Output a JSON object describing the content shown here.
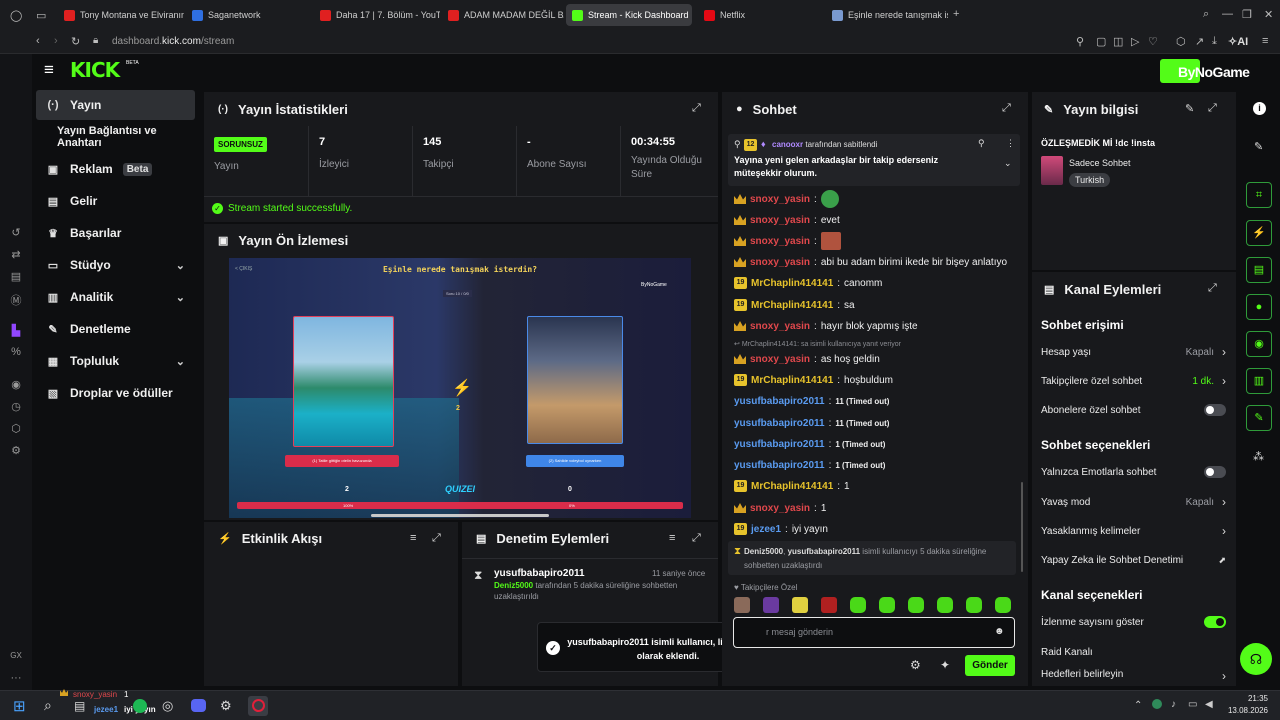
{
  "browser": {
    "tabs": [
      {
        "label": "Tony Montana ve Elviranın",
        "color": "#e02020"
      },
      {
        "label": "Saganetwork",
        "color": "#2f6fe0"
      },
      {
        "label": "Daha 17 | 7. Bölüm - YouTu",
        "color": "#e02020"
      },
      {
        "label": "ADAM MADAM DEĞİL BAM",
        "color": "#e02020"
      },
      {
        "label": "Stream - Kick Dashboard",
        "color": "#53fc18"
      },
      {
        "label": "Netflix",
        "color": "#e50914"
      },
      {
        "label": "Eşinle nerede tanışmak iste",
        "color": "#7a9ad0"
      }
    ],
    "new_tab": "+",
    "url_host": "dashboard.",
    "url_domain": "kick.com",
    "url_path": "/stream",
    "ai_label": "AI",
    "gx_label": "GX"
  },
  "kick": {
    "logo": "KICK",
    "logo_beta": "BETA",
    "brand": "ByNoGame"
  },
  "nav": [
    {
      "label": "Yayın",
      "icon": "broadcast-icon",
      "glyph": "(·)"
    },
    {
      "label": "Yayın Bağlantısı ve Anahtarı",
      "icon": "",
      "glyph": ""
    },
    {
      "label": "Reklam",
      "icon": "ad-icon",
      "glyph": "▣",
      "badge": "Beta"
    },
    {
      "label": "Gelir",
      "icon": "revenue-icon",
      "glyph": "▤"
    },
    {
      "label": "Başarılar",
      "icon": "trophy-icon",
      "glyph": "♛"
    },
    {
      "label": "Stüdyo",
      "icon": "studio-icon",
      "glyph": "▭"
    },
    {
      "label": "Analitik",
      "icon": "analytics-icon",
      "glyph": "▥"
    },
    {
      "label": "Denetleme",
      "icon": "wrench-icon",
      "glyph": "✎"
    },
    {
      "label": "Topluluk",
      "icon": "community-icon",
      "glyph": "▦"
    },
    {
      "label": "Droplar ve ödüller",
      "icon": "drops-icon",
      "glyph": "▧"
    }
  ],
  "stats": {
    "title": "Yayın İstatistikleri",
    "status_badge": "SORUNSUZ",
    "status_label": "Yayın",
    "viewers": "7",
    "viewers_label": "İzleyici",
    "followers": "145",
    "followers_label": "Takipçi",
    "subs": "-",
    "subs_label": "Abone Sayısı",
    "uptime": "00:34:55",
    "uptime_label": "Yayında Olduğu Süre",
    "success_msg": "Stream started successfully."
  },
  "preview": {
    "title": "Yayın Ön İzlemesi",
    "quiz_title": "Eşinle nerede tanışmak isterdin?",
    "left_option": "(1) Tatile gittiğin otelin havuzunda",
    "right_option": "(2) Sahilde voleybol oynarken",
    "left_score": "2",
    "right_score": "0",
    "center_score": "2",
    "logo": "QUIZEI",
    "top_label": "Soru 10 / 0/0",
    "back": "< ÇIKIŞ",
    "watermark": "ByNoGame",
    "left_pct": "100%",
    "right_pct": "0%"
  },
  "events": {
    "title": "Etkinlik Akışı"
  },
  "moderation": {
    "title": "Denetim Eylemleri",
    "item_user": "yusufbabapiro2011",
    "item_time": "11 saniye önce",
    "item_actor": "Deniz5000",
    "item_text": " tarafından 5 dakika süreliğine sohbetten uzaklaştırıldı"
  },
  "toast": {
    "text": "yusufbabapiro2011 isimli kullanıcı, listenize vip olarak eklendi."
  },
  "chat": {
    "title": "Sohbet",
    "pinned_badge": "12",
    "pinned_by": "canooxr",
    "pinned_by_suffix": " tarafından sabitlendi",
    "pinned_text": "Yayına yeni gelen arkadaşlar bir takip ederseniz müteşekkir olurum.",
    "messages": [
      {
        "user": "snoxy_yasin",
        "text": "",
        "badge": "crown",
        "color": "red",
        "emote": "#3aa04a"
      },
      {
        "user": "snoxy_yasin",
        "text": "evet",
        "badge": "crown",
        "color": "red"
      },
      {
        "user": "snoxy_yasin",
        "text": "",
        "badge": "crown",
        "color": "red",
        "emote": "#b0533e"
      },
      {
        "user": "snoxy_yasin",
        "text": "abi bu adam birimi ikede bir bişey anlatıyo",
        "badge": "crown",
        "color": "red"
      },
      {
        "user": "MrChaplin414141",
        "text": "canomm",
        "badge": "19",
        "color": "yel"
      },
      {
        "user": "MrChaplin414141",
        "text": "sa",
        "badge": "19",
        "color": "yel"
      },
      {
        "user": "snoxy_yasin",
        "text": "hayır blok yapmış işte",
        "badge": "crown",
        "color": "red"
      },
      {
        "user": "snoxy_yasin",
        "text": "as hoş geldin",
        "badge": "crown",
        "color": "red"
      },
      {
        "user": "MrChaplin414141",
        "text": "hoşbuldum",
        "badge": "19",
        "color": "yel"
      },
      {
        "user": "yusufbabapiro2011",
        "text": "11 (Timed out)",
        "badge": "",
        "color": "blue"
      },
      {
        "user": "yusufbabapiro2011",
        "text": "11 (Timed out)",
        "badge": "",
        "color": "blue"
      },
      {
        "user": "yusufbabapiro2011",
        "text": "1 (Timed out)",
        "badge": "",
        "color": "blue"
      },
      {
        "user": "yusufbabapiro2011",
        "text": "1 (Timed out)",
        "badge": "",
        "color": "blue"
      },
      {
        "user": "MrChaplin414141",
        "text": "1",
        "badge": "19",
        "color": "yel"
      },
      {
        "user": "snoxy_yasin",
        "text": "1",
        "badge": "crown",
        "color": "red"
      },
      {
        "user": "jezee1",
        "text": "iyi yayın",
        "badge": "19",
        "color": "blue"
      }
    ],
    "reply_hint": "MrChaplin414141: sa isimli kullanıcıya yanıt veriyor",
    "timeout_notice_actor": "Deniz5000",
    "timeout_notice_target": "yusufbabapiro2011",
    "timeout_notice_text": " isimli kullanıcıyı 5 dakika süreliğine sohbetten uzaklaştırdı",
    "emote_row_label": "♥ Takipçilere Özel",
    "input_placeholder": "r mesaj gönderin",
    "send": "Gönder"
  },
  "stream_info": {
    "title": "Yayın bilgisi",
    "stream_title": "ÖZLEŞMEDİK Mİ !dc !insta",
    "category": "Sadece Sohbet",
    "language": "Turkish"
  },
  "channel_actions": {
    "title": "Kanal Eylemleri",
    "chat_access": "Sohbet erişimi",
    "account_age": "Hesap yaşı",
    "account_age_val": "Kapalı",
    "followers_only": "Takipçilere özel sohbet",
    "followers_only_val": "1 dk.",
    "subs_only": "Abonelere özel sohbet",
    "chat_options": "Sohbet seçenekleri",
    "emotes_only": "Yalnızca Emotlarla sohbet",
    "slow_mode": "Yavaş mod",
    "slow_mode_val": "Kapalı",
    "banned_words": "Yasaklanmış kelimeler",
    "ai_mod": "Yapay Zeka ile Sohbet Denetimi",
    "channel_options": "Kanal seçenekleri",
    "show_viewers": "İzlenme sayısını göster",
    "raid": "Raid Kanalı",
    "goals": "Hedefleri belirleyin"
  },
  "taskbar": {
    "notif_user": "snoxy_yasin",
    "notif_num": "1",
    "notif_user2": "jezee1",
    "notif_text": "iyi yayın",
    "time": "21:35",
    "date": "13.08.2026"
  },
  "colors": {
    "kick_green": "#53fc18",
    "panel": "#18191c",
    "bg": "#0d0e10"
  }
}
